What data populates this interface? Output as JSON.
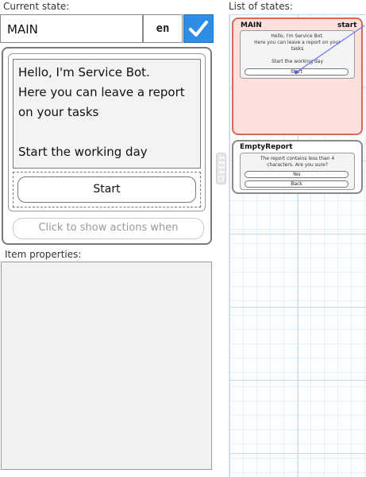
{
  "labels": {
    "current_state": "Current state:",
    "list_of_states": "List of states:",
    "item_properties": "Item properties:"
  },
  "state_editor": {
    "state_name": "MAIN",
    "language": "en",
    "message_text": "Hello, I'm Service Bot.\nHere you can leave a report on your tasks\n\nStart the working day",
    "buttons": [
      "Start"
    ],
    "actions_button": "Click to show actions when"
  },
  "states": [
    {
      "title": "MAIN",
      "badge": "start",
      "text": "Hello, I'm Service Bot.\nHere you can leave a report on your\ntasks\n\nStart the working day",
      "buttons": [
        "Start"
      ],
      "active": true
    },
    {
      "title": "EmptyReport",
      "badge": "",
      "text": "The report contains less than 4\ncharacters. Are you sure?",
      "buttons": [
        "Yes",
        "Back"
      ],
      "active": false
    }
  ],
  "colors": {
    "accent": "#2f8de4",
    "active_state_fill": "#fbe0dc",
    "active_state_border": "#d96a55",
    "connector": "#6b74ff"
  },
  "icons": {
    "confirm": "checkmark-icon",
    "splitter": "drag-handle-icon"
  }
}
